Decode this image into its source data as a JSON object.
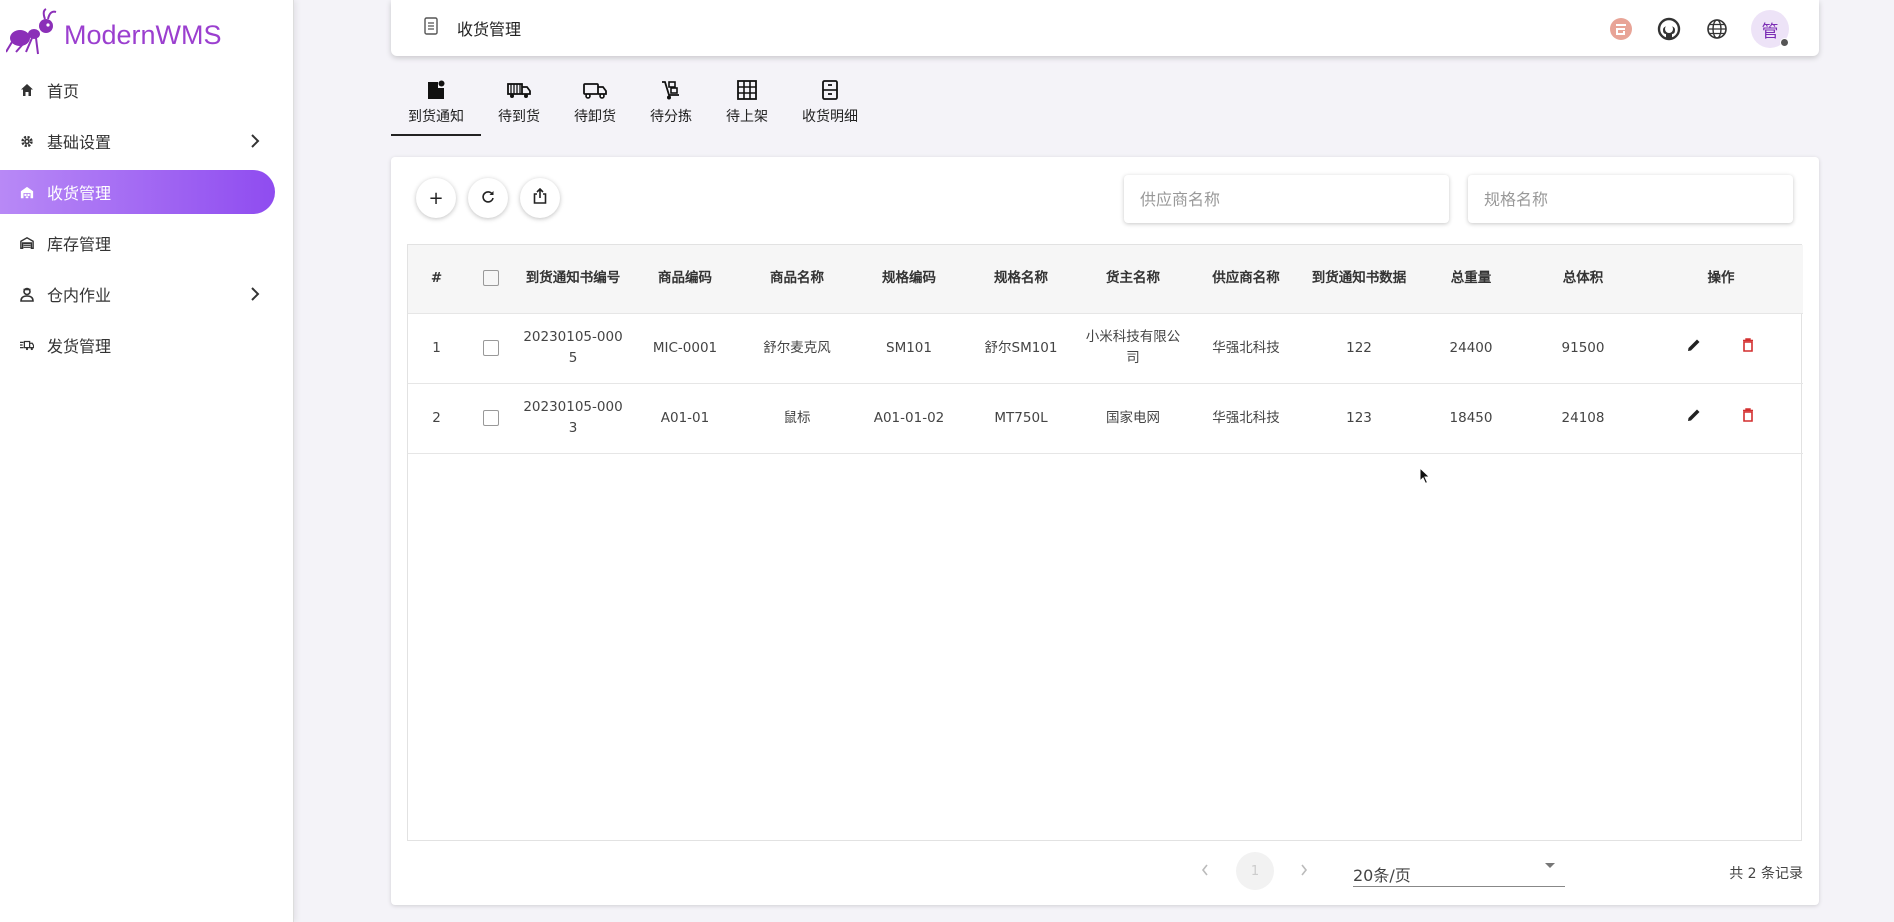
{
  "app": {
    "name": "ModernWMS"
  },
  "sidebar": {
    "items": [
      {
        "label": "首页",
        "icon": "home-icon",
        "expandable": false,
        "active": false
      },
      {
        "label": "基础设置",
        "icon": "gear-icon",
        "expandable": true,
        "active": false
      },
      {
        "label": "收货管理",
        "icon": "warehouse-icon",
        "expandable": false,
        "active": true
      },
      {
        "label": "库存管理",
        "icon": "store-icon",
        "expandable": false,
        "active": false
      },
      {
        "label": "仓内作业",
        "icon": "worker-icon",
        "expandable": true,
        "active": false
      },
      {
        "label": "发货管理",
        "icon": "truck-fast-icon",
        "expandable": false,
        "active": false
      }
    ]
  },
  "header": {
    "title": "收货管理",
    "avatar_text": "管",
    "icons": [
      "gitee-icon",
      "github-icon",
      "globe-icon"
    ]
  },
  "tabs": [
    {
      "label": "到货通知",
      "icon": "file-notice-icon",
      "active": true
    },
    {
      "label": "待到货",
      "icon": "truck-icon",
      "active": false
    },
    {
      "label": "待卸货",
      "icon": "truck-outline-icon",
      "active": false
    },
    {
      "label": "待分拣",
      "icon": "hand-truck-icon",
      "active": false
    },
    {
      "label": "待上架",
      "icon": "grid-icon",
      "active": false
    },
    {
      "label": "收货明细",
      "icon": "file-cabinet-icon",
      "active": false
    }
  ],
  "toolbar": {
    "add_label": "+",
    "supplier_placeholder": "供应商名称",
    "spec_placeholder": "规格名称"
  },
  "table": {
    "headers": [
      "#",
      "",
      "到货通知书编号",
      "商品编码",
      "商品名称",
      "规格编码",
      "规格名称",
      "货主名称",
      "供应商名称",
      "到货通知书数据",
      "总重量",
      "总体积",
      "操作"
    ],
    "rows": [
      [
        "1",
        "",
        "20230105-0005",
        "MIC-0001",
        "舒尔麦克风",
        "SM101",
        "舒尔SM101",
        "小米科技有限公司",
        "华强北科技",
        "122",
        "24400",
        "91500"
      ],
      [
        "2",
        "",
        "20230105-0003",
        "A01-01",
        "鼠标",
        "A01-01-02",
        "MT750L",
        "国家电网",
        "华强北科技",
        "123",
        "18450",
        "24108"
      ]
    ]
  },
  "pagination": {
    "current_page": "1",
    "page_size": "20条/页",
    "total": "共 2 条记录"
  },
  "colors": {
    "brand": "#9b3fcf",
    "active_nav_start": "#b889f6",
    "active_nav_end": "#8f4cf0",
    "delete": "#d32f2f"
  }
}
